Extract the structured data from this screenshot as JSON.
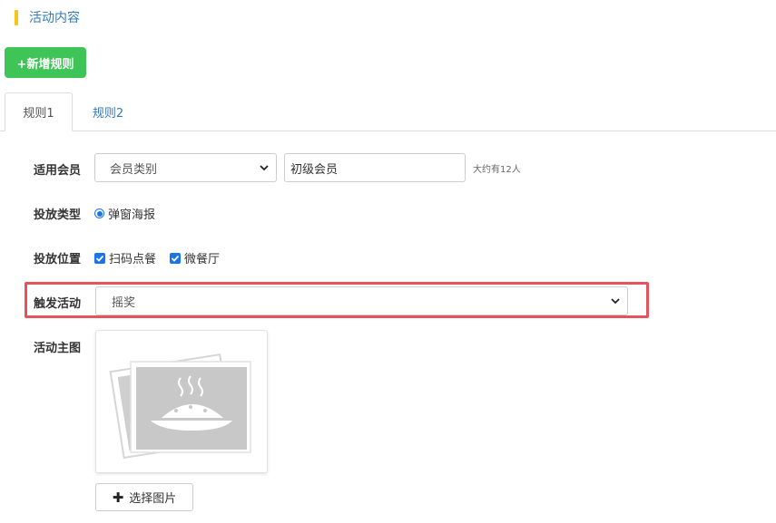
{
  "section": {
    "title": "活动内容"
  },
  "toolbar": {
    "add_rule_label": "+新增规则"
  },
  "tabs": [
    {
      "label": "规则1"
    },
    {
      "label": "规则2"
    }
  ],
  "form": {
    "member": {
      "label": "适用会员",
      "type_select": "会员类别",
      "level_value": "初级会员",
      "estimate": "大约有12人"
    },
    "delivery_type": {
      "label": "投放类型",
      "option": "弹窗海报"
    },
    "delivery_position": {
      "label": "投放位置",
      "options": [
        "扫码点餐",
        "微餐厅"
      ]
    },
    "trigger": {
      "label": "触发活动",
      "value": "摇奖"
    },
    "main_image": {
      "label": "活动主图",
      "choose_label": "选择图片"
    }
  },
  "colors": {
    "accent_blue": "#337ab7",
    "add_button_green": "#3ec457",
    "highlight_red": "#e5535c",
    "title_bar_yellow": "#f5c518"
  }
}
